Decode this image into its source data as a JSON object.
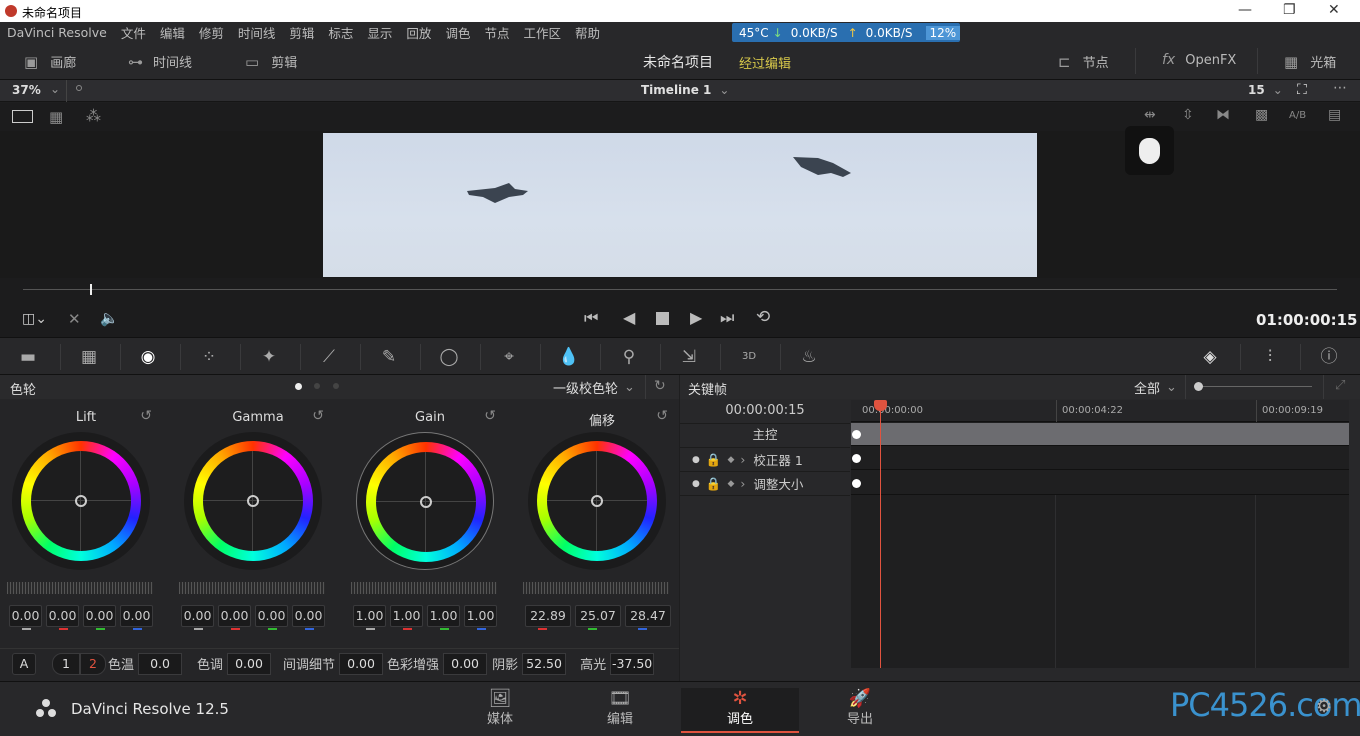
{
  "window": {
    "title": "未命名项目"
  },
  "menu": [
    "DaVinci Resolve",
    "文件",
    "编辑",
    "修剪",
    "时间线",
    "剪辑",
    "标志",
    "显示",
    "回放",
    "调色",
    "节点",
    "工作区",
    "帮助"
  ],
  "sysmon": {
    "temp": "45°C",
    "down": "0.0KB/S",
    "up": "0.0KB/S",
    "cpu": "12%"
  },
  "nav": {
    "gallery": "画廊",
    "timeline": "时间线",
    "clips": "剪辑",
    "project": "未命名项目",
    "status": "经过编辑",
    "nodes": "节点",
    "openfx": "OpenFX",
    "lightbox": "光箱"
  },
  "viewer": {
    "zoom": "37%",
    "timeline": "Timeline 1",
    "frame": "15",
    "ab": "A/B",
    "timecode": "01:00:00:15"
  },
  "wheels": {
    "title": "色轮",
    "mode": "一级校色轮",
    "items": [
      {
        "name": "Lift",
        "vals": [
          "0.00",
          "0.00",
          "0.00",
          "0.00"
        ]
      },
      {
        "name": "Gamma",
        "vals": [
          "0.00",
          "0.00",
          "0.00",
          "0.00"
        ]
      },
      {
        "name": "Gain",
        "vals": [
          "1.00",
          "1.00",
          "1.00",
          "1.00"
        ]
      },
      {
        "name": "偏移",
        "vals": [
          "22.89",
          "25.07",
          "28.47"
        ]
      }
    ]
  },
  "adjust": {
    "auto": "A",
    "p1": "1",
    "p2": "2",
    "temp_l": "色温",
    "temp": "0.0",
    "tint_l": "色调",
    "tint": "0.00",
    "md_l": "间调细节",
    "md": "0.00",
    "cb_l": "色彩增强",
    "cb": "0.00",
    "sh_l": "阴影",
    "sh": "52.50",
    "hl_l": "高光",
    "hl": "-37.50"
  },
  "keyframes": {
    "title": "关键帧",
    "filter": "全部",
    "tc": "00:00:00:15",
    "ruler": [
      "00:00:00:00",
      "00:00:04:22",
      "00:00:09:19"
    ],
    "rows": [
      "主控",
      "校正器 1",
      "调整大小"
    ]
  },
  "bottom": {
    "app": "DaVinci Resolve 12.5",
    "tabs": [
      "媒体",
      "编辑",
      "调色",
      "导出"
    ],
    "watermark": "PC4526.com"
  },
  "colors": {
    "accent": "#e0533f",
    "active_status": "#d7c84a",
    "sysmon": "#2a6fb0"
  }
}
